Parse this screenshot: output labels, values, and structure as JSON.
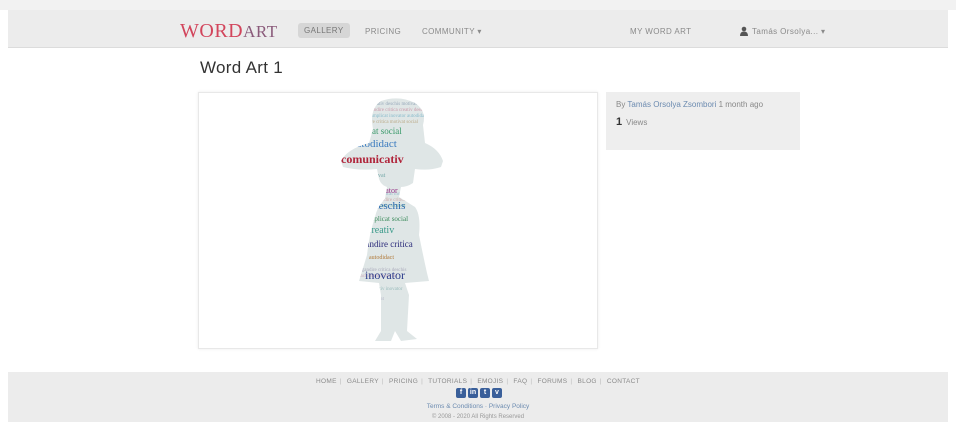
{
  "header": {
    "logo_word": "WORD",
    "logo_art": "ART",
    "nav": [
      "GALLERY",
      "PRICING",
      "COMMUNITY ▾"
    ],
    "my_word_art": "MY WORD ART",
    "user": "Tamás Orsolya... ▾"
  },
  "main": {
    "title": "Word Art 1",
    "info": {
      "by_prefix": "By ",
      "author": "Tamás Orsolya Zsombori",
      "time": " 1 month ago",
      "views_count": "1",
      "views_label": "Views"
    },
    "words": [
      "comunicativ",
      "autodidact",
      "inovator",
      "deschis",
      "creativ",
      "gandire critica",
      "implicat social",
      "motivat",
      "inovator"
    ]
  },
  "footer": {
    "links": [
      "HOME",
      "GALLERY",
      "PRICING",
      "TUTORIALS",
      "EMOJIS",
      "FAQ",
      "FORUMS",
      "BLOG",
      "CONTACT"
    ],
    "social": [
      "f",
      "in",
      "t",
      "v"
    ],
    "terms": "Terms & Conditions · Privacy Policy",
    "copyright": "© 2008 - 2020 All Rights Reserved"
  },
  "colors": {
    "logo": "#d2455c",
    "link": "#6c8bb0",
    "navbar": "#ececec"
  }
}
